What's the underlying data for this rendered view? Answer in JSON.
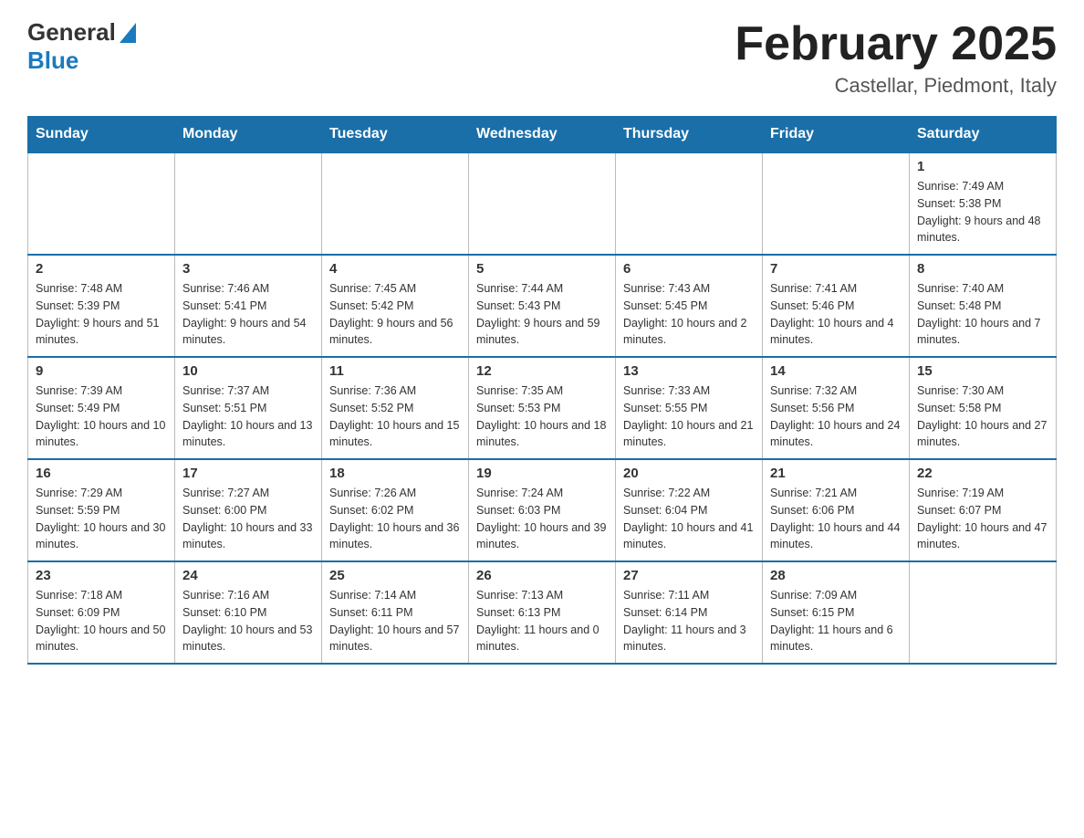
{
  "logo": {
    "general": "General",
    "blue": "Blue"
  },
  "title": "February 2025",
  "location": "Castellar, Piedmont, Italy",
  "days_of_week": [
    "Sunday",
    "Monday",
    "Tuesday",
    "Wednesday",
    "Thursday",
    "Friday",
    "Saturday"
  ],
  "weeks": [
    [
      {
        "day": "",
        "info": ""
      },
      {
        "day": "",
        "info": ""
      },
      {
        "day": "",
        "info": ""
      },
      {
        "day": "",
        "info": ""
      },
      {
        "day": "",
        "info": ""
      },
      {
        "day": "",
        "info": ""
      },
      {
        "day": "1",
        "info": "Sunrise: 7:49 AM\nSunset: 5:38 PM\nDaylight: 9 hours and 48 minutes."
      }
    ],
    [
      {
        "day": "2",
        "info": "Sunrise: 7:48 AM\nSunset: 5:39 PM\nDaylight: 9 hours and 51 minutes."
      },
      {
        "day": "3",
        "info": "Sunrise: 7:46 AM\nSunset: 5:41 PM\nDaylight: 9 hours and 54 minutes."
      },
      {
        "day": "4",
        "info": "Sunrise: 7:45 AM\nSunset: 5:42 PM\nDaylight: 9 hours and 56 minutes."
      },
      {
        "day": "5",
        "info": "Sunrise: 7:44 AM\nSunset: 5:43 PM\nDaylight: 9 hours and 59 minutes."
      },
      {
        "day": "6",
        "info": "Sunrise: 7:43 AM\nSunset: 5:45 PM\nDaylight: 10 hours and 2 minutes."
      },
      {
        "day": "7",
        "info": "Sunrise: 7:41 AM\nSunset: 5:46 PM\nDaylight: 10 hours and 4 minutes."
      },
      {
        "day": "8",
        "info": "Sunrise: 7:40 AM\nSunset: 5:48 PM\nDaylight: 10 hours and 7 minutes."
      }
    ],
    [
      {
        "day": "9",
        "info": "Sunrise: 7:39 AM\nSunset: 5:49 PM\nDaylight: 10 hours and 10 minutes."
      },
      {
        "day": "10",
        "info": "Sunrise: 7:37 AM\nSunset: 5:51 PM\nDaylight: 10 hours and 13 minutes."
      },
      {
        "day": "11",
        "info": "Sunrise: 7:36 AM\nSunset: 5:52 PM\nDaylight: 10 hours and 15 minutes."
      },
      {
        "day": "12",
        "info": "Sunrise: 7:35 AM\nSunset: 5:53 PM\nDaylight: 10 hours and 18 minutes."
      },
      {
        "day": "13",
        "info": "Sunrise: 7:33 AM\nSunset: 5:55 PM\nDaylight: 10 hours and 21 minutes."
      },
      {
        "day": "14",
        "info": "Sunrise: 7:32 AM\nSunset: 5:56 PM\nDaylight: 10 hours and 24 minutes."
      },
      {
        "day": "15",
        "info": "Sunrise: 7:30 AM\nSunset: 5:58 PM\nDaylight: 10 hours and 27 minutes."
      }
    ],
    [
      {
        "day": "16",
        "info": "Sunrise: 7:29 AM\nSunset: 5:59 PM\nDaylight: 10 hours and 30 minutes."
      },
      {
        "day": "17",
        "info": "Sunrise: 7:27 AM\nSunset: 6:00 PM\nDaylight: 10 hours and 33 minutes."
      },
      {
        "day": "18",
        "info": "Sunrise: 7:26 AM\nSunset: 6:02 PM\nDaylight: 10 hours and 36 minutes."
      },
      {
        "day": "19",
        "info": "Sunrise: 7:24 AM\nSunset: 6:03 PM\nDaylight: 10 hours and 39 minutes."
      },
      {
        "day": "20",
        "info": "Sunrise: 7:22 AM\nSunset: 6:04 PM\nDaylight: 10 hours and 41 minutes."
      },
      {
        "day": "21",
        "info": "Sunrise: 7:21 AM\nSunset: 6:06 PM\nDaylight: 10 hours and 44 minutes."
      },
      {
        "day": "22",
        "info": "Sunrise: 7:19 AM\nSunset: 6:07 PM\nDaylight: 10 hours and 47 minutes."
      }
    ],
    [
      {
        "day": "23",
        "info": "Sunrise: 7:18 AM\nSunset: 6:09 PM\nDaylight: 10 hours and 50 minutes."
      },
      {
        "day": "24",
        "info": "Sunrise: 7:16 AM\nSunset: 6:10 PM\nDaylight: 10 hours and 53 minutes."
      },
      {
        "day": "25",
        "info": "Sunrise: 7:14 AM\nSunset: 6:11 PM\nDaylight: 10 hours and 57 minutes."
      },
      {
        "day": "26",
        "info": "Sunrise: 7:13 AM\nSunset: 6:13 PM\nDaylight: 11 hours and 0 minutes."
      },
      {
        "day": "27",
        "info": "Sunrise: 7:11 AM\nSunset: 6:14 PM\nDaylight: 11 hours and 3 minutes."
      },
      {
        "day": "28",
        "info": "Sunrise: 7:09 AM\nSunset: 6:15 PM\nDaylight: 11 hours and 6 minutes."
      },
      {
        "day": "",
        "info": ""
      }
    ]
  ]
}
